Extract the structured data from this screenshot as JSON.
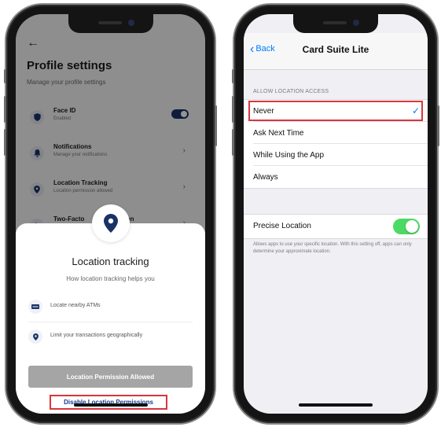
{
  "left_screen": {
    "profile": {
      "back_icon": "arrow-left",
      "title": "Profile settings",
      "subtitle": "Manage your profile settings",
      "rows": [
        {
          "label": "Face ID",
          "sub": "Enabled",
          "icon": "shield-icon",
          "control": "toggle",
          "toggle_on": true
        },
        {
          "label": "Notifications",
          "sub": "Manage your notifications",
          "icon": "bell-icon",
          "control": "chevron"
        },
        {
          "label": "Location Tracking",
          "sub": "Location permission allowed",
          "icon": "location-pin-icon",
          "control": "chevron"
        },
        {
          "label": "Two-Facto",
          "label_end": "ation",
          "sub": "",
          "icon": "key-icon",
          "control": "chevron"
        }
      ]
    },
    "sheet": {
      "title": "Location tracking",
      "subtitle": "How location tracking helps you",
      "features": [
        {
          "icon": "atm-icon",
          "label": "Locate nearby ATMs"
        },
        {
          "icon": "location-pin-icon",
          "label": "Limit your transactions geographically"
        }
      ],
      "primary_button": "Location Permission Allowed",
      "link_button": "Disable Location Permissions"
    }
  },
  "right_screen": {
    "nav": {
      "back_label": "Back",
      "title": "Card Suite Lite"
    },
    "section_header": "ALLOW LOCATION ACCESS",
    "options": [
      {
        "label": "Never",
        "selected": true
      },
      {
        "label": "Ask Next Time",
        "selected": false
      },
      {
        "label": "While Using the App",
        "selected": false
      },
      {
        "label": "Always",
        "selected": false
      }
    ],
    "precise": {
      "label": "Precise Location",
      "on": true
    },
    "footnote": "Allows apps to use your specific location. With this setting off, apps can only determine your approximate location."
  },
  "colors": {
    "accent_navy": "#1a3366",
    "ios_blue": "#007aff",
    "ios_green": "#4cd964",
    "highlight_red": "#d9363e"
  }
}
